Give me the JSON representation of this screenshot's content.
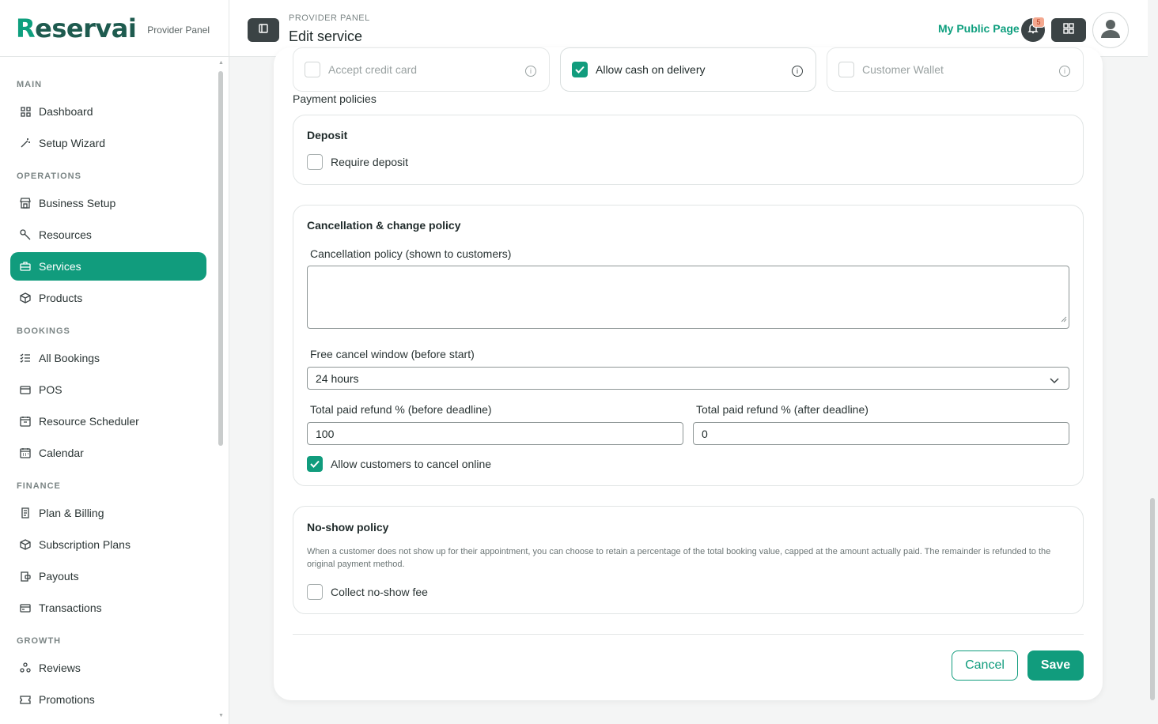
{
  "brand": {
    "logo_text": "Reservai",
    "subtitle": "Provider Panel"
  },
  "sidebar": {
    "sections": [
      {
        "title": "MAIN",
        "items": [
          {
            "label": "Dashboard",
            "icon": "grid-icon"
          },
          {
            "label": "Setup Wizard",
            "icon": "magic-wand-icon"
          }
        ]
      },
      {
        "title": "OPERATIONS",
        "items": [
          {
            "label": "Business Setup",
            "icon": "store-icon"
          },
          {
            "label": "Resources",
            "icon": "wrench-icon"
          },
          {
            "label": "Services",
            "icon": "briefcase-icon",
            "active": true
          },
          {
            "label": "Products",
            "icon": "box-icon"
          }
        ]
      },
      {
        "title": "BOOKINGS",
        "items": [
          {
            "label": "All Bookings",
            "icon": "list-check-icon"
          },
          {
            "label": "POS",
            "icon": "card-icon"
          },
          {
            "label": "Resource Scheduler",
            "icon": "calendar-grid-icon"
          },
          {
            "label": "Calendar",
            "icon": "calendar-icon"
          }
        ]
      },
      {
        "title": "FINANCE",
        "items": [
          {
            "label": "Plan & Billing",
            "icon": "receipt-icon"
          },
          {
            "label": "Subscription Plans",
            "icon": "box-icon"
          },
          {
            "label": "Payouts",
            "icon": "wallet-icon"
          },
          {
            "label": "Transactions",
            "icon": "card-icon"
          }
        ]
      },
      {
        "title": "GROWTH",
        "items": [
          {
            "label": "Reviews",
            "icon": "people-icon"
          },
          {
            "label": "Promotions",
            "icon": "ticket-icon"
          }
        ]
      }
    ]
  },
  "header": {
    "breadcrumb": "PROVIDER PANEL",
    "title": "Edit service",
    "public_page_label": "My Public Page",
    "notification_count": "5"
  },
  "payment_methods": [
    {
      "label": "Accept credit card",
      "checked": false,
      "enabled": false
    },
    {
      "label": "Allow cash on delivery",
      "checked": true,
      "enabled": true
    },
    {
      "label": "Customer Wallet",
      "checked": false,
      "enabled": false
    }
  ],
  "payment_policies_label": "Payment policies",
  "deposit": {
    "title": "Deposit",
    "require_label": "Require deposit",
    "checked": false
  },
  "cancellation": {
    "title": "Cancellation & change policy",
    "policy_label": "Cancellation policy (shown to customers)",
    "policy_value": "",
    "window_label": "Free cancel window (before start)",
    "window_value": "24 hours",
    "refund_before_label": "Total paid refund % (before deadline)",
    "refund_before_value": "100",
    "refund_after_label": "Total paid refund % (after deadline)",
    "refund_after_value": "0",
    "allow_online_label": "Allow customers to cancel online",
    "allow_online_checked": true
  },
  "no_show": {
    "title": "No-show policy",
    "description": "When a customer does not show up for their appointment, you can choose to retain a percentage of the total booking value, capped at the amount actually paid. The remainder is refunded to the original payment method.",
    "collect_label": "Collect no-show fee",
    "checked": false
  },
  "actions": {
    "cancel_label": "Cancel",
    "save_label": "Save"
  },
  "colors": {
    "accent": "#119c7d",
    "dark": "#3b4345",
    "badge": "#f4a88f"
  }
}
